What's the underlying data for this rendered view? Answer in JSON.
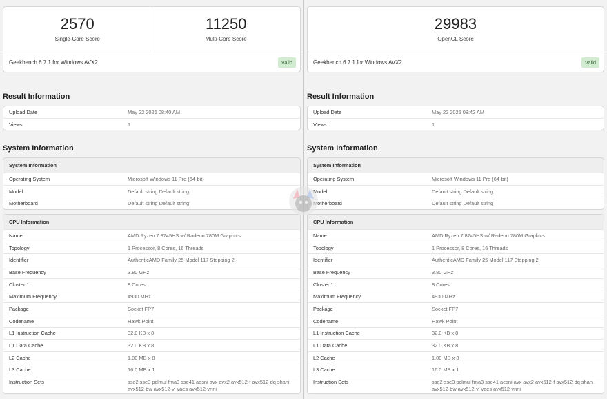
{
  "left": {
    "scores": [
      {
        "value": "2570",
        "label": "Single-Core Score"
      },
      {
        "value": "11250",
        "label": "Multi-Core Score"
      }
    ],
    "version": "Geekbench 6.7.1 for Windows AVX2",
    "badge": "Valid",
    "result_title": "Result Information",
    "result_rows": [
      {
        "k": "Upload Date",
        "v": "May 22 2026 08:40 AM"
      },
      {
        "k": "Views",
        "v": "1"
      }
    ],
    "system_title": "System Information",
    "sys_head": "System Information",
    "sys_rows": [
      {
        "k": "Operating System",
        "v": "Microsoft Windows 11 Pro (64-bit)"
      },
      {
        "k": "Model",
        "v": "Default string Default string"
      },
      {
        "k": "Motherboard",
        "v": "Default string Default string"
      }
    ],
    "cpu_head": "CPU Information",
    "cpu_rows": [
      {
        "k": "Name",
        "v": "AMD Ryzen 7 8745HS w/ Radeon 780M Graphics"
      },
      {
        "k": "Topology",
        "v": "1 Processor, 8 Cores, 16 Threads"
      },
      {
        "k": "Identifier",
        "v": "AuthenticAMD Family 25 Model 117 Stepping 2"
      },
      {
        "k": "Base Frequency",
        "v": "3.80 GHz"
      },
      {
        "k": "Cluster 1",
        "v": "8 Cores"
      },
      {
        "k": "Maximum Frequency",
        "v": "4930 MHz"
      },
      {
        "k": "Package",
        "v": "Socket FP7"
      },
      {
        "k": "Codename",
        "v": "Hawk Point"
      },
      {
        "k": "L1 Instruction Cache",
        "v": "32.0 KB x 8"
      },
      {
        "k": "L1 Data Cache",
        "v": "32.0 KB x 8"
      },
      {
        "k": "L2 Cache",
        "v": "1.00 MB x 8"
      },
      {
        "k": "L3 Cache",
        "v": "16.0 MB x 1"
      },
      {
        "k": "Instruction Sets",
        "v": "sse2 sse3 pclmul fma3 sse41 aesni avx avx2 avx512-f avx512-dq shani avx512-bw avx512-vl vaes avx512-vnni"
      }
    ]
  },
  "right": {
    "scores": [
      {
        "value": "29983",
        "label": "OpenCL Score"
      }
    ],
    "version": "Geekbench 6.7.1 for Windows AVX2",
    "badge": "Valid",
    "result_title": "Result Information",
    "result_rows": [
      {
        "k": "Upload Date",
        "v": "May 22 2026 08:42 AM"
      },
      {
        "k": "Views",
        "v": "1"
      }
    ],
    "system_title": "System Information",
    "sys_head": "System Information",
    "sys_rows": [
      {
        "k": "Operating System",
        "v": "Microsoft Windows 11 Pro (64-bit)"
      },
      {
        "k": "Model",
        "v": "Default string Default string"
      },
      {
        "k": "Motherboard",
        "v": "Default string Default string"
      }
    ],
    "cpu_head": "CPU Information",
    "cpu_rows": [
      {
        "k": "Name",
        "v": "AMD Ryzen 7 8745HS w/ Radeon 780M Graphics"
      },
      {
        "k": "Topology",
        "v": "1 Processor, 8 Cores, 16 Threads"
      },
      {
        "k": "Identifier",
        "v": "AuthenticAMD Family 25 Model 117 Stepping 2"
      },
      {
        "k": "Base Frequency",
        "v": "3.80 GHz"
      },
      {
        "k": "Cluster 1",
        "v": "8 Cores"
      },
      {
        "k": "Maximum Frequency",
        "v": "4930 MHz"
      },
      {
        "k": "Package",
        "v": "Socket FP7"
      },
      {
        "k": "Codename",
        "v": "Hawk Point"
      },
      {
        "k": "L1 Instruction Cache",
        "v": "32.0 KB x 8"
      },
      {
        "k": "L1 Data Cache",
        "v": "32.0 KB x 8"
      },
      {
        "k": "L2 Cache",
        "v": "1.00 MB x 8"
      },
      {
        "k": "L3 Cache",
        "v": "16.0 MB x 1"
      },
      {
        "k": "Instruction Sets",
        "v": "sse2 sse3 pclmul fma3 sse41 aesni avx avx2 avx512-f avx512-dq shani avx512-bw avx512-vl vaes avx512-vnni"
      }
    ]
  },
  "colors": {
    "badge_bg": "#d2ecd2",
    "badge_text": "#3f6b3f",
    "table_head_bg": "#eeeeee"
  },
  "watermark_icon": "channel-logo-icon"
}
